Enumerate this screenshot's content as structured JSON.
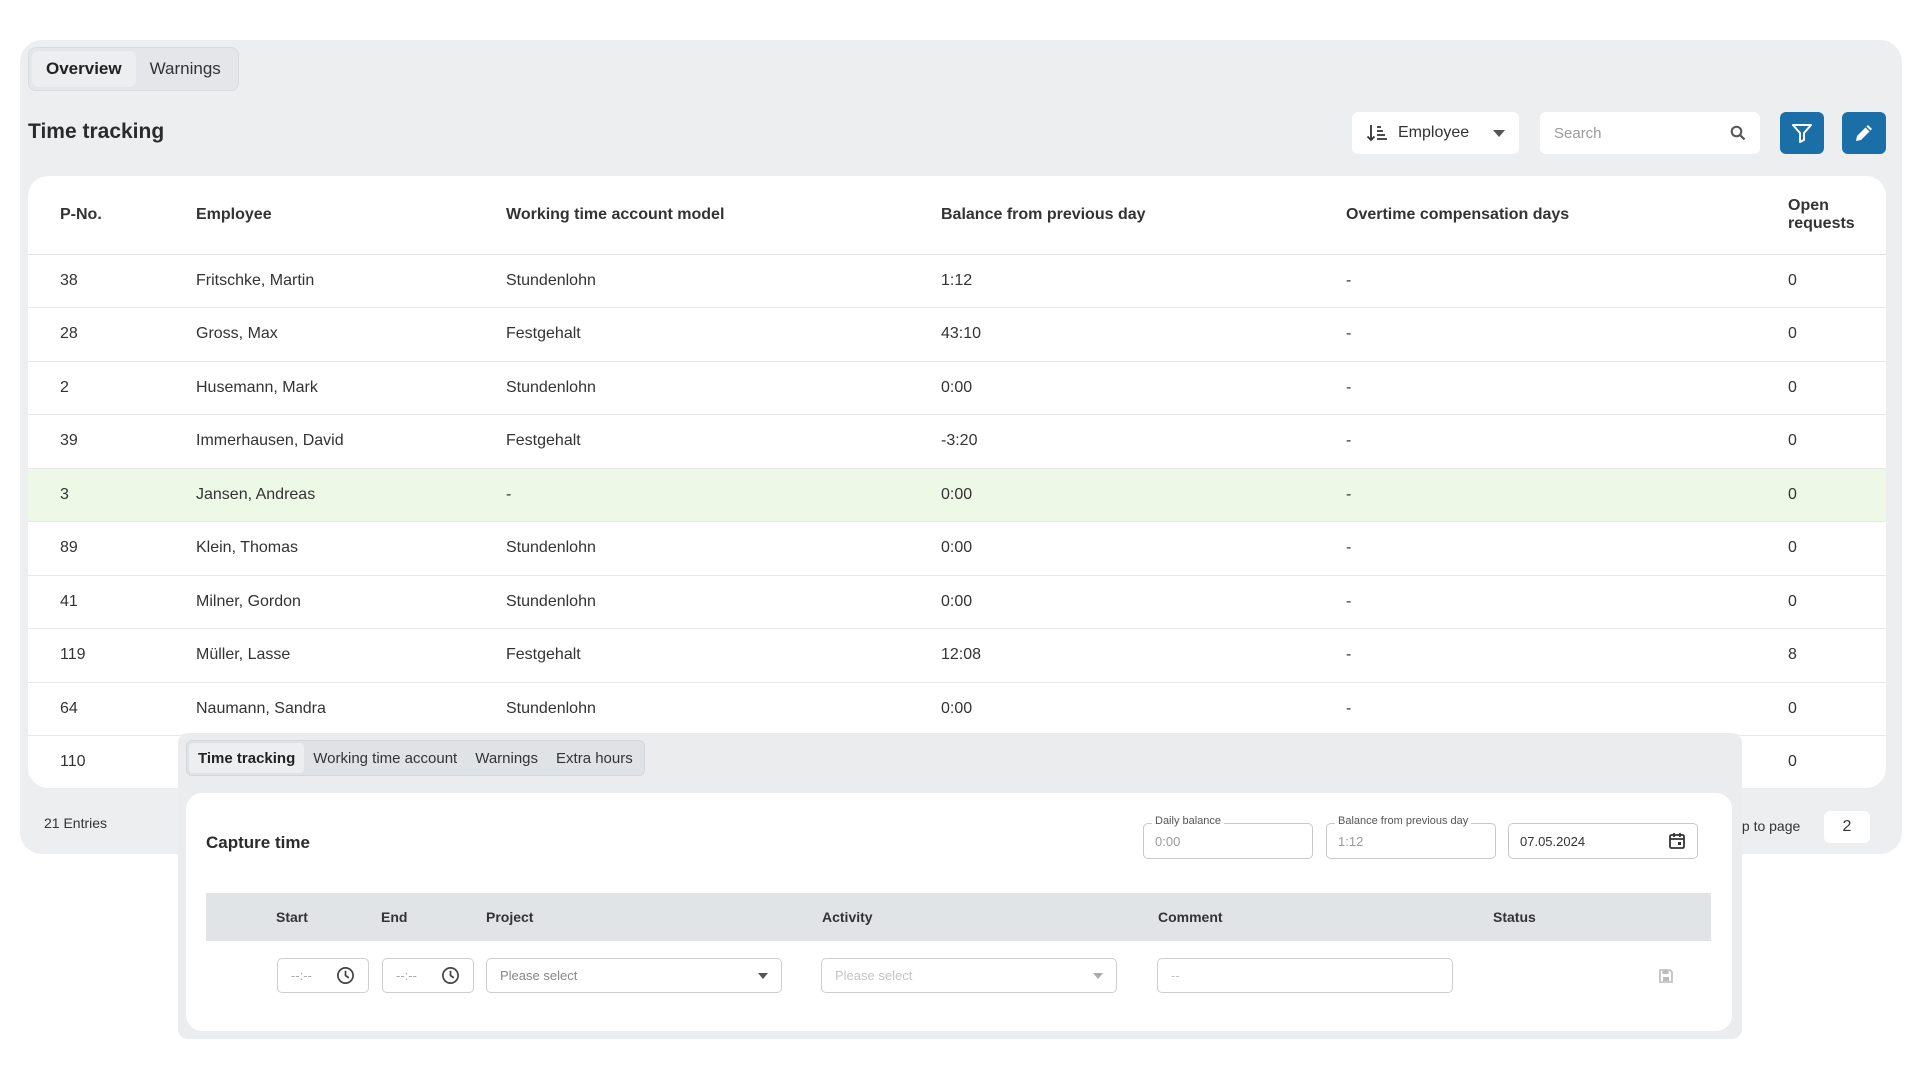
{
  "tabs": [
    {
      "label": "Overview",
      "active": true
    },
    {
      "label": "Warnings",
      "active": false
    }
  ],
  "page_title": "Time tracking",
  "sort_select": {
    "label": "Employee",
    "icon": "sort-ascending-icon"
  },
  "search": {
    "placeholder": "Search",
    "value": "",
    "icon": "search-icon"
  },
  "toolbar": {
    "filter_icon": "filter-icon",
    "edit_icon": "pencil-icon",
    "accent_color": "#1a6fa8"
  },
  "table": {
    "columns": [
      "P-No.",
      "Employee",
      "Working time account model",
      "Balance from previous day",
      "Overtime compensation days",
      "Open requests"
    ],
    "rows": [
      {
        "pno": "38",
        "employee": "Fritschke, Martin",
        "model": "Stundenlohn",
        "balance": "1:12",
        "overtime": "-",
        "open": "0"
      },
      {
        "pno": "28",
        "employee": "Gross, Max",
        "model": "Festgehalt",
        "balance": "43:10",
        "overtime": "-",
        "open": "0"
      },
      {
        "pno": "2",
        "employee": "Husemann, Mark",
        "model": "Stundenlohn",
        "balance": "0:00",
        "overtime": "-",
        "open": "0"
      },
      {
        "pno": "39",
        "employee": "Immerhausen, David",
        "model": "Festgehalt",
        "balance": "-3:20",
        "overtime": "-",
        "open": "0"
      },
      {
        "pno": "3",
        "employee": "Jansen, Andreas",
        "model": "-",
        "balance": "0:00",
        "overtime": "-",
        "open": "0",
        "highlight": true
      },
      {
        "pno": "89",
        "employee": "Klein, Thomas",
        "model": "Stundenlohn",
        "balance": "0:00",
        "overtime": "-",
        "open": "0"
      },
      {
        "pno": "41",
        "employee": "Milner, Gordon",
        "model": "Stundenlohn",
        "balance": "0:00",
        "overtime": "-",
        "open": "0"
      },
      {
        "pno": "119",
        "employee": "Müller, Lasse",
        "model": "Festgehalt",
        "balance": "12:08",
        "overtime": "-",
        "open": "8"
      },
      {
        "pno": "64",
        "employee": "Naumann, Sandra",
        "model": "Stundenlohn",
        "balance": "0:00",
        "overtime": "-",
        "open": "0"
      },
      {
        "pno": "110",
        "employee": "",
        "model": "",
        "balance": "",
        "overtime": "",
        "open": "0"
      }
    ],
    "highlight_color": "#eef8e6"
  },
  "footer": {
    "entries": "21 Entries",
    "jump_label": "ıp to page",
    "jump_value": "2"
  },
  "panel": {
    "tabs": [
      {
        "label": "Time tracking",
        "active": true
      },
      {
        "label": "Working time account",
        "active": false
      },
      {
        "label": "Warnings",
        "active": false
      },
      {
        "label": "Extra hours",
        "active": false
      }
    ],
    "title": "Capture time",
    "daily_balance": {
      "label": "Daily balance",
      "value": "0:00"
    },
    "balance_prev": {
      "label": "Balance from previous day",
      "value": "1:12"
    },
    "date": {
      "value": "07.05.2024",
      "icon": "calendar-icon"
    },
    "columns": [
      "Start",
      "End",
      "Project",
      "Activity",
      "Comment",
      "Status"
    ],
    "entry": {
      "start_placeholder": "--:--",
      "end_placeholder": "--:--",
      "project_placeholder": "Please select",
      "activity_placeholder": "Please select",
      "comment_placeholder": "--",
      "save_icon": "save-icon"
    }
  }
}
